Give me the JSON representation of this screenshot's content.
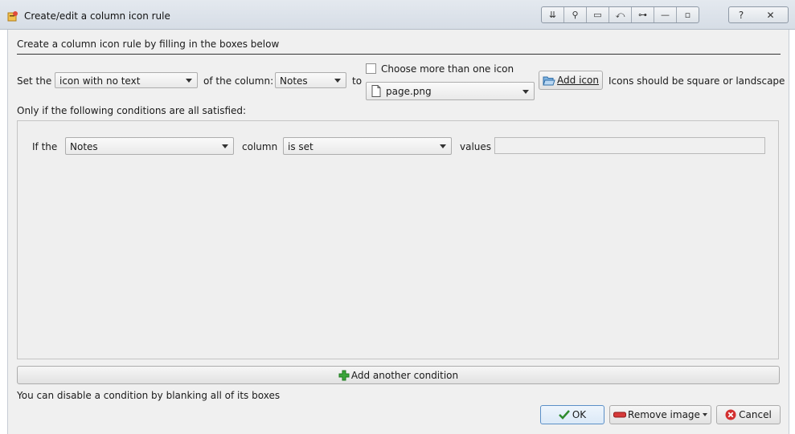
{
  "window": {
    "title": "Create/edit a column icon rule"
  },
  "heading": "Create a column icon rule by filling in the boxes below",
  "rule_row": {
    "set_the_label": "Set the",
    "kind_value": "icon with no text",
    "of_column_label": "of the column:",
    "column_value": "Notes",
    "to_label": "to",
    "multi_icon_label": "Choose more than one icon",
    "multi_icon_checked": false,
    "icon_file_value": "page.png",
    "add_icon_label": "Add icon",
    "icons_hint": "Icons should be square or landscape"
  },
  "conditions_label": "Only if the following conditions are all satisfied:",
  "condition": {
    "if_the_label": "If the",
    "column_value": "Notes",
    "column_label": "column",
    "action_value": "is set",
    "values_label": "values",
    "values_value": ""
  },
  "add_condition_label": "Add another condition",
  "disable_hint": "You can disable a condition by blanking all of its boxes",
  "buttons": {
    "ok": "OK",
    "remove_image": "Remove image",
    "cancel": "Cancel"
  },
  "colors": {
    "ok_check": "#2e8b2e",
    "plus": "#3aa53a",
    "remove": "#c62828",
    "cancel": "#c62828"
  }
}
